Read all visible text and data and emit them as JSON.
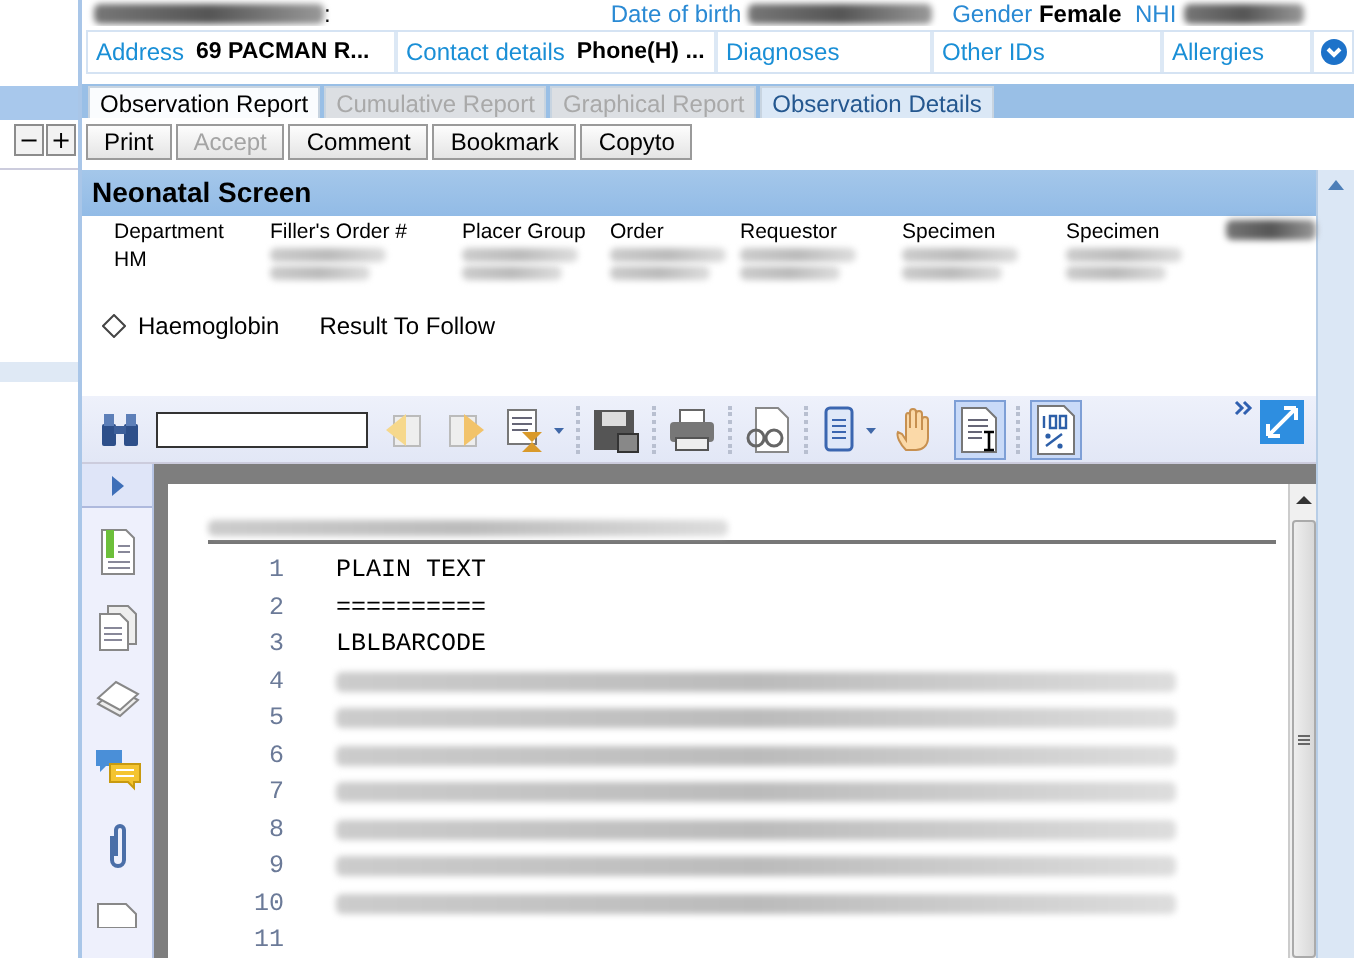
{
  "patient_bar": {
    "name_label_end": ":",
    "date_of_birth_label": "Date of birth",
    "gender_label": "Gender",
    "gender": "Female",
    "nhi_label": "NHI"
  },
  "left_panel": {
    "zoom_buttons": [
      "−",
      "+"
    ]
  },
  "info_fields": [
    {
      "label": "Address",
      "value": "69 PACMAN R..."
    },
    {
      "label": "Contact details",
      "value": "Phone(H) ..."
    },
    {
      "label": "Diagnoses"
    },
    {
      "label": "Other IDs"
    },
    {
      "label": "Allergies"
    }
  ],
  "tabs": [
    {
      "label": "Observation Report",
      "selected": true,
      "disabled": false
    },
    {
      "label": "Cumulative Report",
      "selected": false,
      "disabled": true
    },
    {
      "label": "Graphical Report",
      "selected": false,
      "disabled": true
    },
    {
      "label": "Observation Details",
      "selected": false,
      "disabled": false
    }
  ],
  "buttons": [
    {
      "label": "Print",
      "disabled": false
    },
    {
      "label": "Accept",
      "disabled": true
    },
    {
      "label": "Comment",
      "disabled": false
    },
    {
      "label": "Bookmark",
      "disabled": false
    },
    {
      "label": "Copyto",
      "disabled": false
    }
  ],
  "report": {
    "title": "Neonatal Screen",
    "columns": [
      {
        "heading": "Department",
        "value": "HM"
      },
      {
        "heading": "Filler's Order #"
      },
      {
        "heading": "Placer Group"
      },
      {
        "heading": "Order"
      },
      {
        "heading": "Requestor"
      },
      {
        "heading": "Specimen"
      },
      {
        "heading": "Specimen"
      }
    ],
    "tests": [
      {
        "name": "Haemoglobin",
        "status": "Result To Follow"
      }
    ]
  },
  "toolbar": [
    {
      "kind": "find",
      "pressed": false
    },
    {
      "kind": "field"
    },
    {
      "kind": "prev",
      "pressed": false
    },
    {
      "kind": "next",
      "pressed": false
    },
    {
      "kind": "history",
      "pressed": false
    },
    {
      "kind": "sep"
    },
    {
      "kind": "save",
      "pressed": false
    },
    {
      "kind": "sep"
    },
    {
      "kind": "printer",
      "pressed": false
    },
    {
      "kind": "sep"
    },
    {
      "kind": "preview",
      "pressed": false
    },
    {
      "kind": "sep"
    },
    {
      "kind": "pages",
      "pressed": false
    },
    {
      "kind": "hand",
      "pressed": false
    },
    {
      "kind": "textselect",
      "pressed": true
    },
    {
      "kind": "sep"
    },
    {
      "kind": "zoom100",
      "pressed": true
    }
  ],
  "document": {
    "lines": [
      {
        "number": "1",
        "text": "PLAIN TEXT",
        "redacted": false
      },
      {
        "number": "2",
        "text": "==========",
        "redacted": false
      },
      {
        "number": "3",
        "text": "LBLBARCODE",
        "redacted": false
      },
      {
        "number": "4",
        "redacted": true
      },
      {
        "number": "5",
        "redacted": true
      },
      {
        "number": "6",
        "redacted": true
      },
      {
        "number": "7",
        "redacted": true
      },
      {
        "number": "8",
        "redacted": true
      },
      {
        "number": "9",
        "redacted": true
      },
      {
        "number": "10",
        "redacted": true
      },
      {
        "number": "11",
        "redacted": false
      }
    ]
  }
}
